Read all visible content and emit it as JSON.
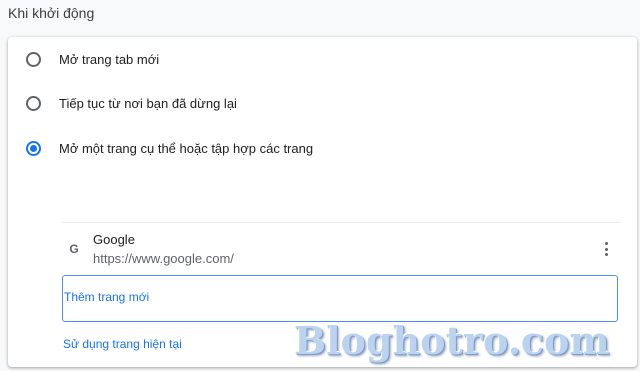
{
  "section": {
    "title": "Khi khởi động"
  },
  "options": [
    {
      "label": "Mở trang tab mới",
      "checked": false
    },
    {
      "label": "Tiếp tục từ nơi bạn đã dừng lại",
      "checked": false
    },
    {
      "label": "Mở một trang cụ thể hoặc tập hợp các trang",
      "checked": true
    }
  ],
  "pages": [
    {
      "name": "Google",
      "url": "https://www.google.com/",
      "favicon": "G"
    }
  ],
  "actions": {
    "add_page": "Thêm trang mới",
    "use_current": "Sử dụng trang hiện tại"
  },
  "watermark": "Bloghotro.com",
  "colors": {
    "accent": "#1a73e8",
    "text": "#202124",
    "secondary_text": "#5f6368"
  }
}
